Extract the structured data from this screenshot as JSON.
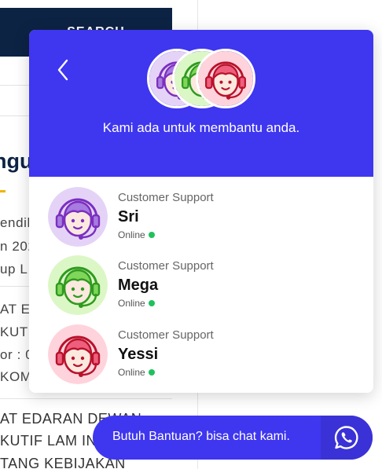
{
  "background": {
    "search_label": "SEARCH",
    "heading_fragment": "ngur",
    "lines": [
      "endil",
      "n 202",
      "up L"
    ],
    "list_lines": [
      "AT ED",
      "KUTI",
      "or : 0",
      "KOM"
    ],
    "bottom_lines": [
      "AT EDARAN DEWAN",
      "KUTIF LAM IN",
      "TANG KEBIJAKAN"
    ]
  },
  "popup": {
    "tagline": "Kami ada untuk membantu anda.",
    "agents": [
      {
        "role": "Customer Support",
        "name": "Sri",
        "status": "Online",
        "theme": "purple"
      },
      {
        "role": "Customer Support",
        "name": "Mega",
        "status": "Online",
        "theme": "green"
      },
      {
        "role": "Customer Support",
        "name": "Yessi",
        "status": "Online",
        "theme": "red"
      }
    ]
  },
  "launcher": {
    "label": "Butuh Bantuan? bisa chat kami."
  },
  "colors": {
    "primary": "#3f36f0",
    "online": "#1fc15f",
    "purple": "#7b2fbf",
    "green": "#2f9a1f",
    "red": "#b8122b"
  },
  "icons": {
    "back": "chevron-left-icon",
    "chat": "whatsapp-icon",
    "avatar": "support-agent-icon"
  }
}
